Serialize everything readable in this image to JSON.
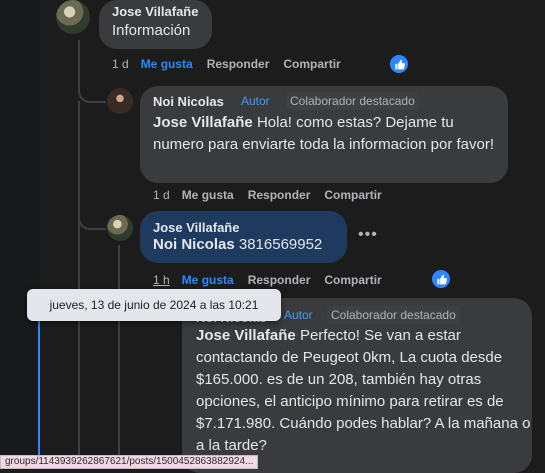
{
  "comments": [
    {
      "author": "Jose Villafañe",
      "text": "Información",
      "time": "1 d",
      "like": "Me gusta",
      "reply": "Responder",
      "share": "Compartir"
    },
    {
      "author": "Noi Nicolas",
      "author_badge": "Autor",
      "contributor_badge": "Colaborador destacado",
      "mention": "Jose Villafañe",
      "text": " Hola! como estas? Dejame tu numero para enviarte toda la informacion por favor!",
      "time": "1 d",
      "like": "Me gusta",
      "reply": "Responder",
      "share": "Compartir"
    },
    {
      "author": "Jose Villafañe",
      "mention": "Noi Nicolas",
      "text": " 3816569952",
      "time": "1 h",
      "like": "Me gusta",
      "reply": "Responder",
      "share": "Compartir"
    },
    {
      "author": "Noi Nicolas",
      "author_badge": "Autor",
      "contributor_badge": "Colaborador destacado",
      "mention": "Jose Villafañe",
      "text": " Perfecto! Se van a estar contactando de Peugeot 0km, La cuota desde $165.000. es de un 208, también hay otras opciones, el anticipo mínimo para retirar es de $7.171.980. Cuándo podes hablar? A la mañana o a la tarde?"
    }
  ],
  "tooltip": "jueves, 13 de junio de 2024 a las 10:21",
  "status_url": "groups/1143939262867621/posts/1500452863882924...",
  "colors": {
    "like_blue": "#2d88ff",
    "bubble": "#3a3b3c",
    "highlight": "#1f3a5f"
  }
}
